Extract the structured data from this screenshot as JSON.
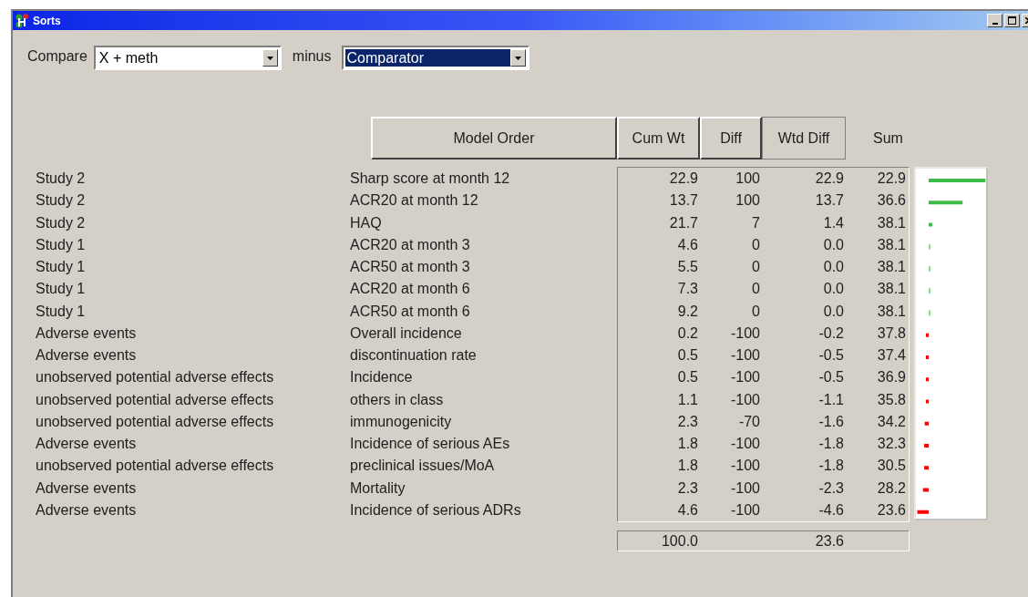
{
  "window": {
    "title": "Sorts"
  },
  "compare": {
    "label": "Compare",
    "value": "X + meth",
    "focused": false
  },
  "minus": {
    "label": "minus",
    "value": "Comparator",
    "focused": true
  },
  "columns": [
    {
      "label": "Model Order",
      "selected": false
    },
    {
      "label": "Cum Wt",
      "selected": false
    },
    {
      "label": "Diff",
      "selected": false
    },
    {
      "label": "Wtd Diff",
      "selected": true
    }
  ],
  "sum_heading": "Sum",
  "rows": [
    {
      "group": "Study 2",
      "item": "Sharp score at month 12",
      "cum_wt": "22.9",
      "diff": "100",
      "wtd_diff": "22.9",
      "sum": "22.9"
    },
    {
      "group": "Study 2",
      "item": "ACR20 at month 12",
      "cum_wt": "13.7",
      "diff": "100",
      "wtd_diff": "13.7",
      "sum": "36.6"
    },
    {
      "group": "Study 2",
      "item": "HAQ",
      "cum_wt": "21.7",
      "diff": "7",
      "wtd_diff": "1.4",
      "sum": "38.1"
    },
    {
      "group": "Study 1",
      "item": "ACR20 at month 3",
      "cum_wt": "4.6",
      "diff": "0",
      "wtd_diff": "0.0",
      "sum": "38.1"
    },
    {
      "group": "Study 1",
      "item": "ACR50 at month 3",
      "cum_wt": "5.5",
      "diff": "0",
      "wtd_diff": "0.0",
      "sum": "38.1"
    },
    {
      "group": "Study 1",
      "item": "ACR20 at month 6",
      "cum_wt": "7.3",
      "diff": "0",
      "wtd_diff": "0.0",
      "sum": "38.1"
    },
    {
      "group": "Study 1",
      "item": "ACR50 at month 6",
      "cum_wt": "9.2",
      "diff": "0",
      "wtd_diff": "0.0",
      "sum": "38.1"
    },
    {
      "group": "Adverse events",
      "item": "Overall incidence",
      "cum_wt": "0.2",
      "diff": "-100",
      "wtd_diff": "-0.2",
      "sum": "37.8"
    },
    {
      "group": "Adverse events",
      "item": "discontinuation rate",
      "cum_wt": "0.5",
      "diff": "-100",
      "wtd_diff": "-0.5",
      "sum": "37.4"
    },
    {
      "group": "unobserved potential adverse effects",
      "item": "Incidence",
      "cum_wt": "0.5",
      "diff": "-100",
      "wtd_diff": "-0.5",
      "sum": "36.9"
    },
    {
      "group": "unobserved potential adverse effects",
      "item": "others in class",
      "cum_wt": "1.1",
      "diff": "-100",
      "wtd_diff": "-1.1",
      "sum": "35.8"
    },
    {
      "group": "unobserved potential adverse effects",
      "item": "immunogenicity",
      "cum_wt": "2.3",
      "diff": "-70",
      "wtd_diff": "-1.6",
      "sum": "34.2"
    },
    {
      "group": "Adverse events",
      "item": "Incidence of serious AEs",
      "cum_wt": "1.8",
      "diff": "-100",
      "wtd_diff": "-1.8",
      "sum": "32.3"
    },
    {
      "group": "unobserved potential adverse effects",
      "item": "preclinical issues/MoA",
      "cum_wt": "1.8",
      "diff": "-100",
      "wtd_diff": "-1.8",
      "sum": "30.5"
    },
    {
      "group": "Adverse events",
      "item": "Mortality",
      "cum_wt": "2.3",
      "diff": "-100",
      "wtd_diff": "-2.3",
      "sum": "28.2"
    },
    {
      "group": "Adverse events",
      "item": "Incidence of serious ADRs",
      "cum_wt": "4.6",
      "diff": "-100",
      "wtd_diff": "-4.6",
      "sum": "23.6"
    }
  ],
  "totals": {
    "cum_wt": "100.0",
    "wtd_diff": "23.6"
  }
}
